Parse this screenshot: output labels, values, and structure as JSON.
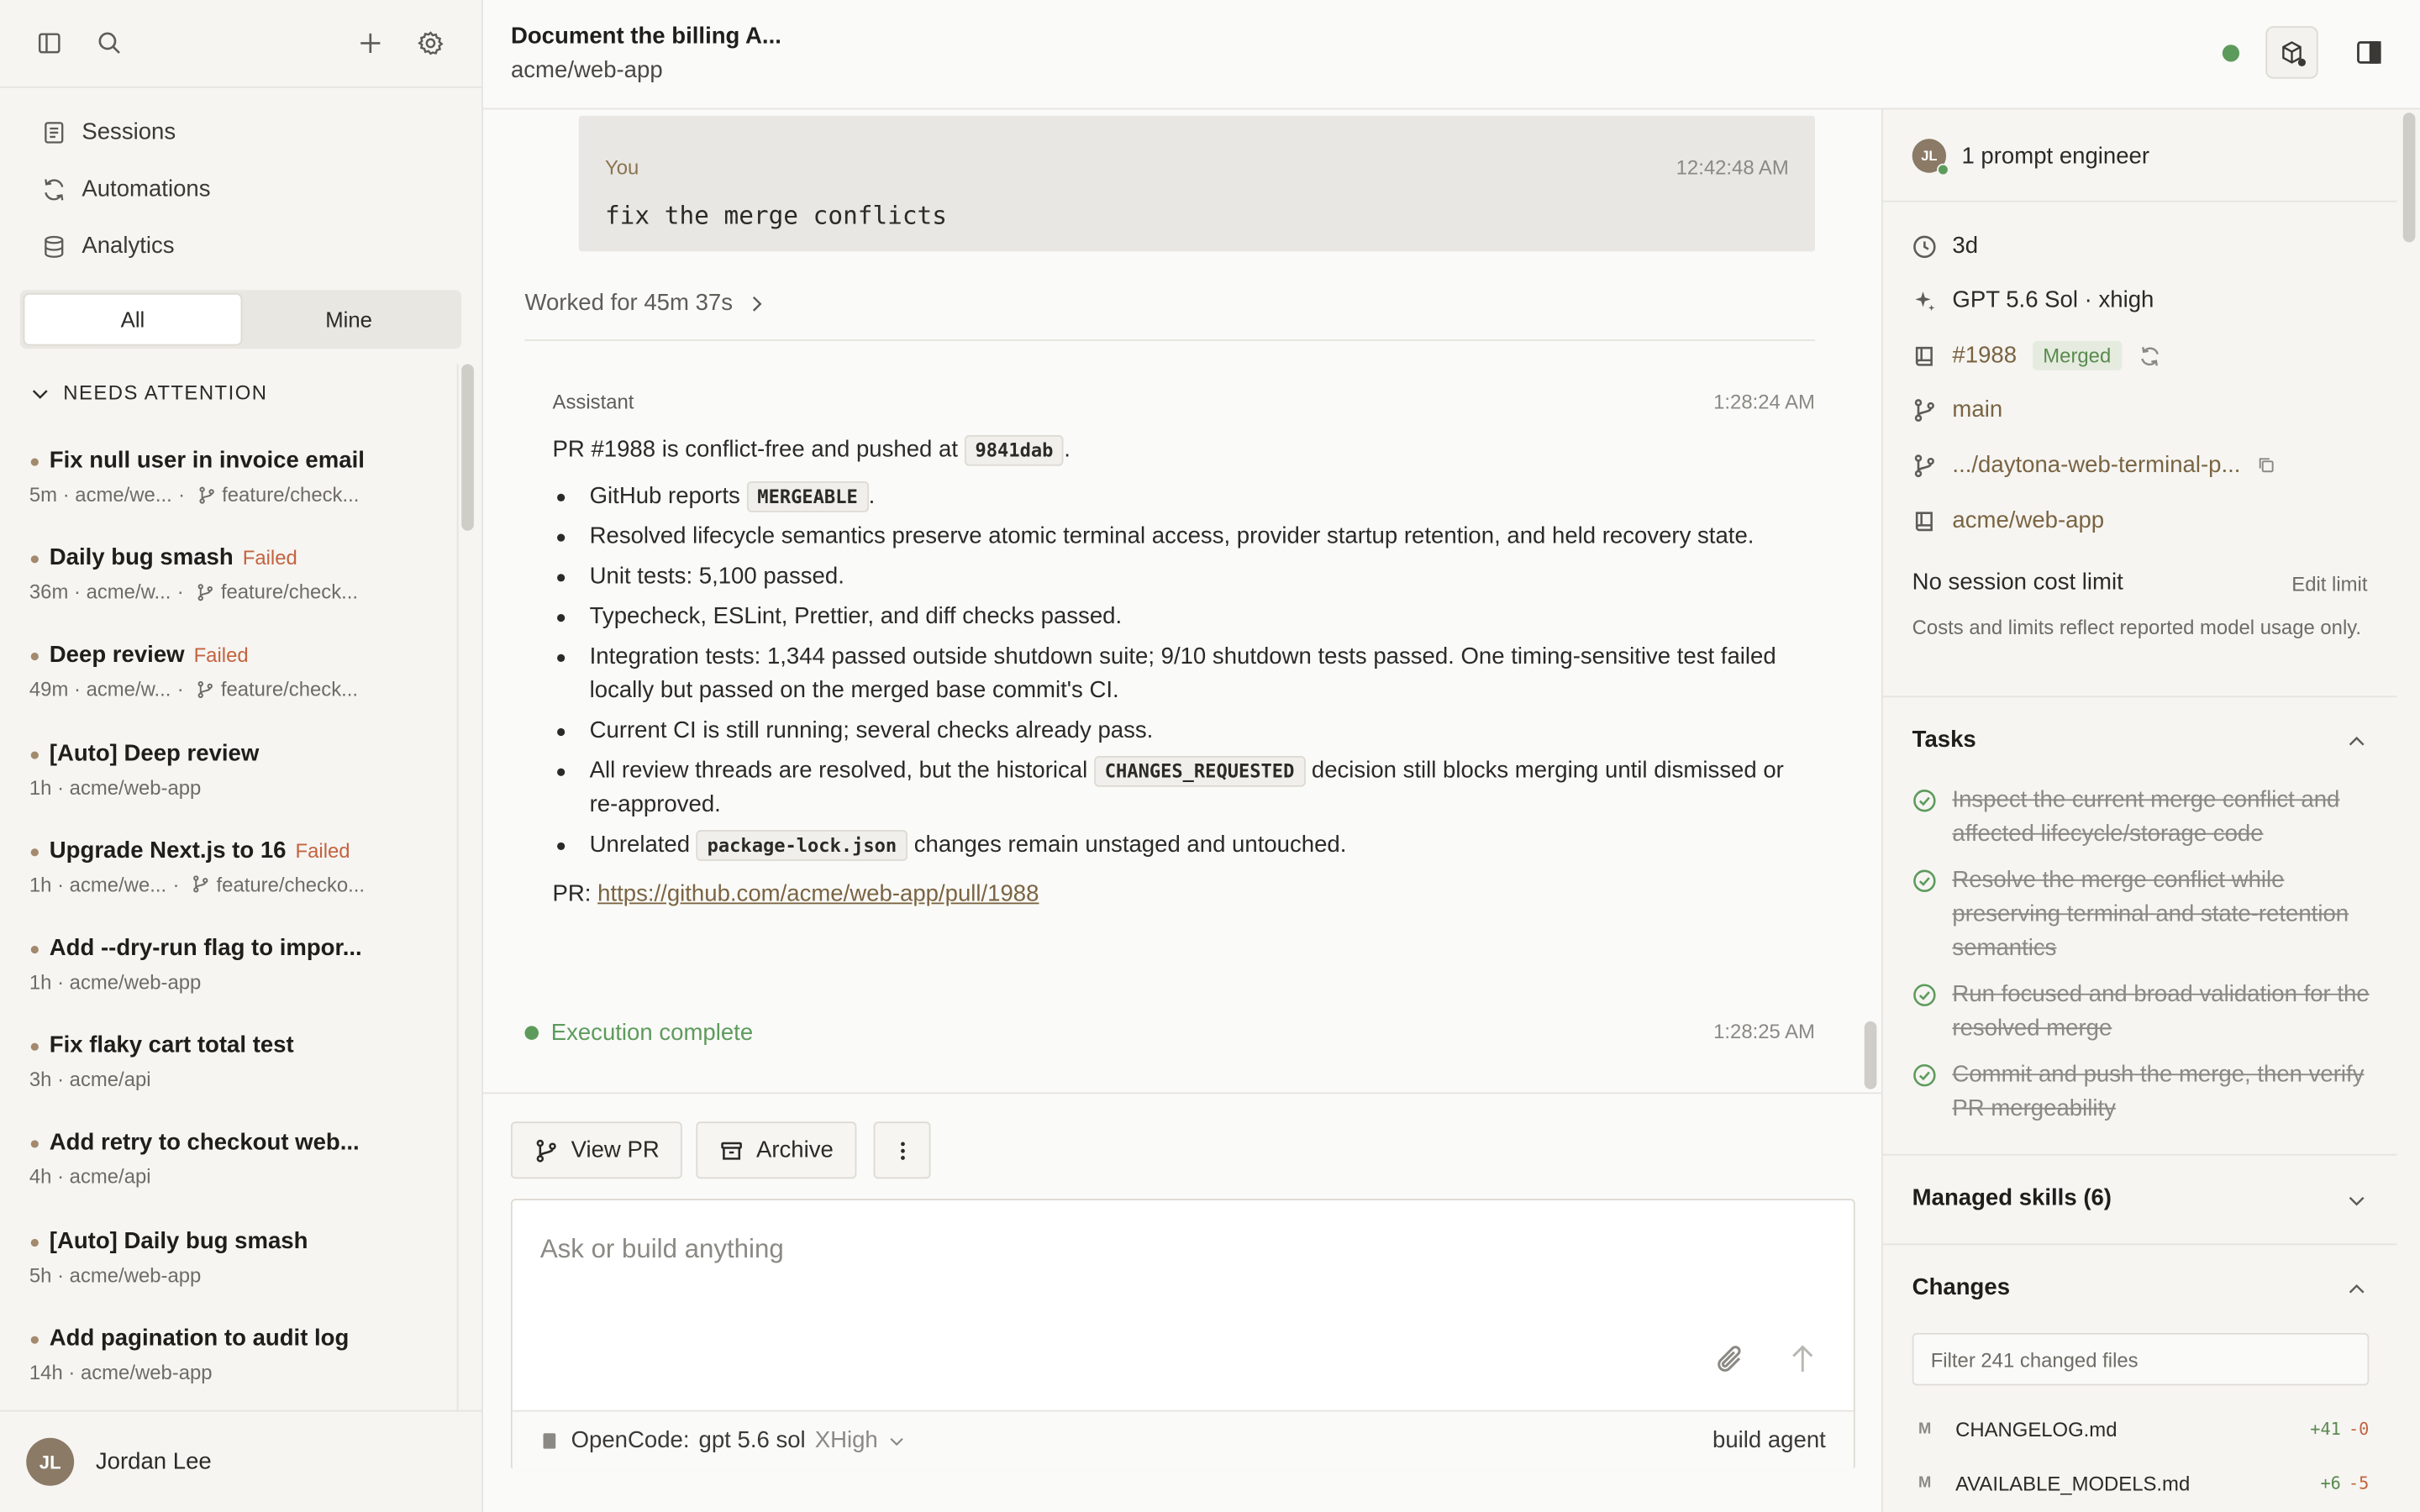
{
  "sidebar": {
    "nav": [
      {
        "label": "Sessions",
        "icon": "document-icon"
      },
      {
        "label": "Automations",
        "icon": "refresh-icon"
      },
      {
        "label": "Analytics",
        "icon": "database-icon"
      }
    ],
    "filter_tabs": [
      "All",
      "Mine"
    ],
    "active_filter": "All",
    "section_title": "NEEDS ATTENTION",
    "sessions": [
      {
        "title": "Fix null user in invoice email",
        "status": "",
        "meta": "5m · acme/we...",
        "branch": "feature/check..."
      },
      {
        "title": "Daily bug smash",
        "status": "Failed",
        "meta": "36m · acme/w...",
        "branch": "feature/check..."
      },
      {
        "title": "Deep review",
        "status": "Failed",
        "meta": "49m · acme/w...",
        "branch": "feature/check..."
      },
      {
        "title": "[Auto] Deep review",
        "status": "",
        "meta": "1h · acme/web-app",
        "branch": ""
      },
      {
        "title": "Upgrade Next.js to 16",
        "status": "Failed",
        "meta": "1h · acme/we...",
        "branch": "feature/checko..."
      },
      {
        "title": "Add --dry-run flag to impor...",
        "status": "",
        "meta": "1h · acme/web-app",
        "branch": ""
      },
      {
        "title": "Fix flaky cart total test",
        "status": "",
        "meta": "3h · acme/api",
        "branch": ""
      },
      {
        "title": "Add retry to checkout web...",
        "status": "",
        "meta": "4h · acme/api",
        "branch": ""
      },
      {
        "title": "[Auto] Daily bug smash",
        "status": "",
        "meta": "5h · acme/web-app",
        "branch": ""
      },
      {
        "title": "Add pagination to audit log",
        "status": "",
        "meta": "14h · acme/web-app",
        "branch": ""
      }
    ],
    "user": {
      "initials": "JL",
      "name": "Jordan Lee"
    }
  },
  "header": {
    "title": "Document the billing A...",
    "repo": "acme/web-app"
  },
  "conversation": {
    "user_message": {
      "label": "You",
      "time": "12:42:48 AM",
      "text": "fix the merge conflicts"
    },
    "worked": "Worked for 45m 37s",
    "assistant": {
      "label": "Assistant",
      "time": "1:28:24 AM",
      "intro_before": "PR #1988 is conflict-free and pushed at",
      "intro_code": "9841dab",
      "intro_after": ".",
      "bullets": {
        "b1_before": "GitHub reports",
        "b1_code": "MERGEABLE",
        "b1_after": ".",
        "b2": "Resolved lifecycle semantics preserve atomic terminal access, provider startup retention, and held recovery state.",
        "b3": "Unit tests: 5,100 passed.",
        "b4": "Typecheck, ESLint, Prettier, and diff checks passed.",
        "b5": "Integration tests: 1,344 passed outside shutdown suite; 9/10 shutdown tests passed. One timing-sensitive test failed locally but passed on the merged base commit's CI.",
        "b6": "Current CI is still running; several checks already pass.",
        "b7_before": "All review threads are resolved, but the historical",
        "b7_code": "CHANGES_REQUESTED",
        "b7_after": "decision still blocks merging until dismissed or re-approved.",
        "b8_before": "Unrelated",
        "b8_code": "package-lock.json",
        "b8_after": "changes remain unstaged and untouched."
      },
      "pr_label": "PR:",
      "pr_url": "https://github.com/acme/web-app/pull/1988"
    },
    "execution": {
      "label": "Execution complete",
      "time": "1:28:25 AM"
    }
  },
  "actions": {
    "view_pr": "View PR",
    "archive": "Archive"
  },
  "composer": {
    "placeholder": "Ask or build anything",
    "model_provider": "OpenCode:",
    "model_name": "gpt 5.6 sol",
    "model_effort": "XHigh",
    "agent": "build agent"
  },
  "right_panel": {
    "participants": "1 prompt engineer",
    "participant_initials": "JL",
    "age": "3d",
    "model": "GPT 5.6 Sol · xhigh",
    "pr_number": "#1988",
    "pr_status": "Merged",
    "base_branch": "main",
    "work_branch": ".../daytona-web-terminal-p...",
    "repo": "acme/web-app",
    "cost_limit": "No session cost limit",
    "edit_limit": "Edit limit",
    "cost_note": "Costs and limits reflect reported model usage only.",
    "tasks_title": "Tasks",
    "tasks": [
      "Inspect the current merge conflict and affected lifecycle/storage code",
      "Resolve the merge conflict while preserving terminal and state-retention semantics",
      "Run focused and broad validation for the resolved merge",
      "Commit and push the merge, then verify PR mergeability"
    ],
    "skills_title": "Managed skills (6)",
    "changes_title": "Changes",
    "filter_placeholder": "Filter 241 changed files",
    "files": [
      {
        "flag": "M",
        "name": "CHANGELOG.md",
        "add": "+41",
        "del": "-0"
      },
      {
        "flag": "M",
        "name": "AVAILABLE_MODELS.md",
        "add": "+6",
        "del": "-5"
      }
    ]
  },
  "colors": {
    "accent_brown": "#7a6442",
    "success_green": "#5d9b5c",
    "failed_orange": "#c4633f",
    "background": "#fafaf8"
  }
}
